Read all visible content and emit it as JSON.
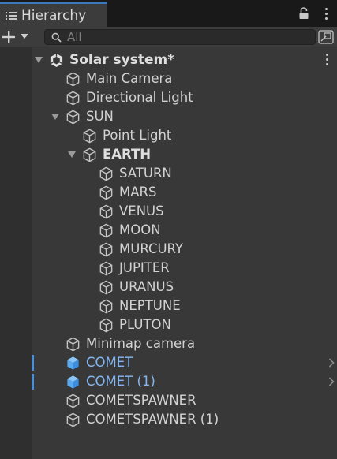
{
  "panel": {
    "title": "Hierarchy",
    "icons": [
      "hamburger-icon",
      "lock-icon",
      "kebab-menu-icon"
    ]
  },
  "toolbar": {
    "create_icon": "plus-icon",
    "search_placeholder": "All",
    "search_value": ""
  },
  "scene": {
    "name": "Solar system*"
  },
  "items": [
    {
      "label": "Main Camera"
    },
    {
      "label": "Directional Light"
    },
    {
      "label": "SUN"
    },
    {
      "label": "Point Light"
    },
    {
      "label": "EARTH"
    },
    {
      "label": "SATURN"
    },
    {
      "label": "MARS"
    },
    {
      "label": "VENUS"
    },
    {
      "label": "MOON"
    },
    {
      "label": "MURCURY"
    },
    {
      "label": "JUPITER"
    },
    {
      "label": "URANUS"
    },
    {
      "label": "NEPTUNE"
    },
    {
      "label": "PLUTON"
    },
    {
      "label": "Minimap camera"
    },
    {
      "label": "COMET"
    },
    {
      "label": "COMET (1)"
    },
    {
      "label": "COMETSPAWNER"
    },
    {
      "label": "COMETSPAWNER (1)"
    }
  ],
  "colors": {
    "background": "#383838",
    "prefab_text": "#86b7f0",
    "prefab_icon": "#5aa9f0",
    "selection_bar": "#4a8fd8",
    "tab_accent": "#3a79bb"
  }
}
